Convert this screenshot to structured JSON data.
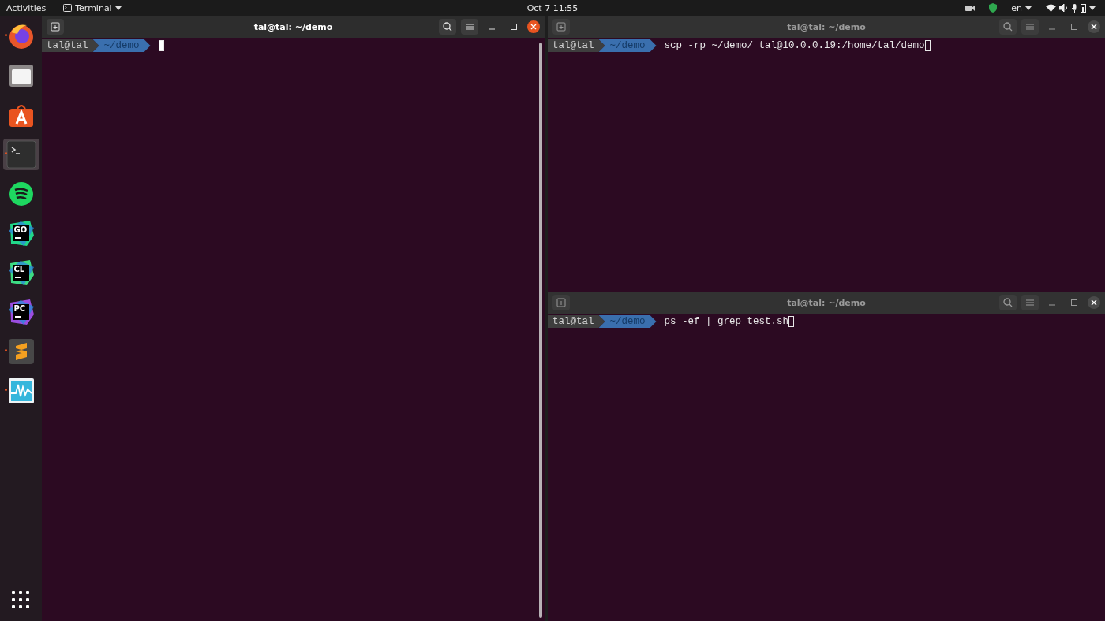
{
  "top_bar": {
    "activities": "Activities",
    "app_menu": "Terminal",
    "clock": "Oct 7  11:55",
    "language": "en"
  },
  "dock": [
    {
      "kind": "firefox",
      "running": true,
      "focused": false
    },
    {
      "kind": "files",
      "running": false,
      "focused": false
    },
    {
      "kind": "store",
      "running": false,
      "focused": false
    },
    {
      "kind": "terminal",
      "running": true,
      "focused": true
    },
    {
      "kind": "spotify",
      "running": false,
      "focused": false
    },
    {
      "kind": "ide",
      "label": "GO",
      "running": false,
      "focused": false
    },
    {
      "kind": "ide",
      "label": "CL",
      "running": false,
      "focused": false
    },
    {
      "kind": "ide",
      "label": "PC",
      "running": false,
      "focused": false
    },
    {
      "kind": "sublime",
      "running": true,
      "focused": false
    },
    {
      "kind": "monitor",
      "running": true,
      "focused": false
    }
  ],
  "terminals": [
    {
      "title": "tal@tal: ~/demo",
      "focused": true,
      "user": "tal@tal",
      "path": "~/demo"
    },
    {
      "title": "tal@tal: ~/demo",
      "focused": false,
      "user": "tal@tal",
      "path": "~/demo",
      "command": "scp -rp ~/demo/ tal@10.0.0.19:/home/tal/demo"
    },
    {
      "title": "tal@tal: ~/demo",
      "focused": false,
      "user": "tal@tal",
      "path": "~/demo",
      "command": "ps -ef | grep test.sh"
    }
  ]
}
